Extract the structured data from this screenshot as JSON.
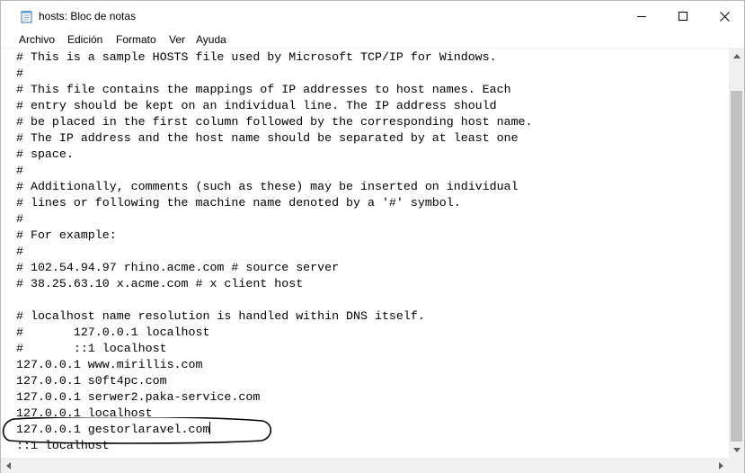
{
  "window": {
    "title": "hosts: Bloc de notas",
    "icon": "notepad-icon"
  },
  "menu": [
    {
      "label": "Archivo"
    },
    {
      "label": "Edición"
    },
    {
      "label": "Formato"
    },
    {
      "label": "Ver"
    },
    {
      "label": "Ayuda"
    }
  ],
  "document": {
    "lines": [
      "# This is a sample HOSTS file used by Microsoft TCP/IP for Windows.",
      "#",
      "# This file contains the mappings of IP addresses to host names. Each",
      "# entry should be kept on an individual line. The IP address should",
      "# be placed in the first column followed by the corresponding host name.",
      "# The IP address and the host name should be separated by at least one",
      "# space.",
      "#",
      "# Additionally, comments (such as these) may be inserted on individual",
      "# lines or following the machine name denoted by a '#' symbol.",
      "#",
      "# For example:",
      "#",
      "# 102.54.94.97 rhino.acme.com # source server",
      "# 38.25.63.10 x.acme.com # x client host",
      "",
      "# localhost name resolution is handled within DNS itself.",
      "#       127.0.0.1 localhost",
      "#       ::1 localhost",
      "127.0.0.1 www.mirillis.com",
      "127.0.0.1 s0ft4pc.com",
      "127.0.0.1 serwer2.paka-service.com",
      "127.0.0.1 localhost",
      "127.0.0.1 gestorlaravel.com",
      "::1 localhost"
    ],
    "caret_line": 23
  },
  "colors": {
    "scroll_track": "#f0f0f0",
    "scroll_thumb": "#c1c1c1",
    "annotation": "#000000"
  }
}
